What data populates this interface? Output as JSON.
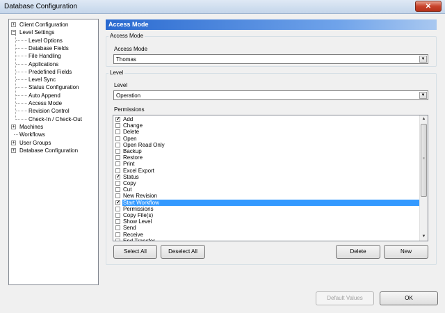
{
  "window": {
    "title": "Database Configuration",
    "close_glyph": "✕"
  },
  "tree": {
    "items": [
      {
        "label": "Client Configuration",
        "level": 0,
        "expander": "+"
      },
      {
        "label": "Level Settings",
        "level": 0,
        "expander": "−"
      },
      {
        "label": "Level Options",
        "level": 1
      },
      {
        "label": "Database Fields",
        "level": 1
      },
      {
        "label": "File Handling",
        "level": 1
      },
      {
        "label": "Applications",
        "level": 1
      },
      {
        "label": "Predefined Fields",
        "level": 1
      },
      {
        "label": "Level Sync",
        "level": 1
      },
      {
        "label": "Status Configuration",
        "level": 1
      },
      {
        "label": "Auto Append",
        "level": 1
      },
      {
        "label": "Access Mode",
        "level": 1
      },
      {
        "label": "Revision Control",
        "level": 1
      },
      {
        "label": "Check-In / Check-Out",
        "level": 1
      },
      {
        "label": "Machines",
        "level": 0,
        "expander": "+"
      },
      {
        "label": "Workflows",
        "level": 0
      },
      {
        "label": "User Groups",
        "level": 0,
        "expander": "+"
      },
      {
        "label": "Database Configuration",
        "level": 0,
        "expander": "+"
      }
    ]
  },
  "panel": {
    "header": "Access Mode",
    "access_group": {
      "legend": "Access Mode",
      "label": "Access Mode",
      "value": "Thomas"
    },
    "level_group": {
      "legend": "Level",
      "label": "Level",
      "value": "Operation",
      "permissions_label": "Permissions",
      "permissions": [
        {
          "label": "Add",
          "checked": true
        },
        {
          "label": "Change",
          "checked": false
        },
        {
          "label": "Delete",
          "checked": false
        },
        {
          "label": "Open",
          "checked": false
        },
        {
          "label": "Open Read Only",
          "checked": false
        },
        {
          "label": "Backup",
          "checked": false
        },
        {
          "label": "Restore",
          "checked": false
        },
        {
          "label": "Print",
          "checked": false
        },
        {
          "label": "Excel Export",
          "checked": false
        },
        {
          "label": "Status",
          "checked": true
        },
        {
          "label": "Copy",
          "checked": false
        },
        {
          "label": "Cut",
          "checked": false
        },
        {
          "label": "New Revision",
          "checked": false
        },
        {
          "label": "Start Workflow",
          "checked": true,
          "selected": true
        },
        {
          "label": "Permissions",
          "checked": false
        },
        {
          "label": "Copy File(s)",
          "checked": false
        },
        {
          "label": "Show Level",
          "checked": false
        },
        {
          "label": "Send",
          "checked": false
        },
        {
          "label": "Receive",
          "checked": false
        },
        {
          "label": "End Transfer",
          "checked": false
        }
      ],
      "buttons": {
        "select_all": "Select All",
        "deselect_all": "Deselect All",
        "delete": "Delete",
        "new": "New"
      }
    }
  },
  "footer": {
    "default_values": "Default Values",
    "ok": "OK"
  },
  "glyphs": {
    "dropdown": "▼",
    "scroll_up": "▲",
    "scroll_down": "▼",
    "check": "✓",
    "grip": "≡"
  }
}
